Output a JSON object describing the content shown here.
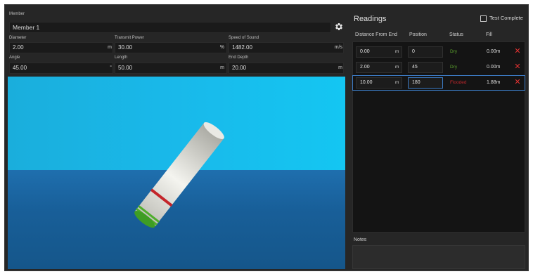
{
  "member": {
    "label": "Member",
    "value": "Member 1"
  },
  "fields": {
    "diameter": {
      "label": "Diameter",
      "value": "2.00",
      "unit": "m"
    },
    "transmit_power": {
      "label": "Transmit Power",
      "value": "30.00",
      "unit": "%"
    },
    "speed_of_sound": {
      "label": "Speed of Sound",
      "value": "1482.00",
      "unit": "m/s"
    },
    "angle": {
      "label": "Angle",
      "value": "45.00",
      "unit": "°"
    },
    "length": {
      "label": "Length",
      "value": "50.00",
      "unit": "m"
    },
    "end_depth": {
      "label": "End Depth",
      "value": "20.00",
      "unit": "m"
    }
  },
  "readings": {
    "title": "Readings",
    "test_complete_label": "Test Complete",
    "test_complete_checked": false,
    "columns": [
      "Distance From End",
      "Position",
      "Status",
      "Fill"
    ],
    "rows": [
      {
        "distance": "0.00",
        "unit": "m",
        "position": "0",
        "status": "Dry",
        "fill": "0.00m"
      },
      {
        "distance": "2.00",
        "unit": "m",
        "position": "45",
        "status": "Dry",
        "fill": "0.00m"
      },
      {
        "distance": "10.00",
        "unit": "m",
        "position": "180",
        "status": "Flooded",
        "fill": "1.88m"
      }
    ],
    "status_colors": {
      "Dry": "#5aa02c",
      "Flooded": "#c0262b"
    }
  },
  "notes": {
    "label": "Notes",
    "value": ""
  },
  "icons": {
    "settings": "gear-icon",
    "delete": "close-icon"
  }
}
